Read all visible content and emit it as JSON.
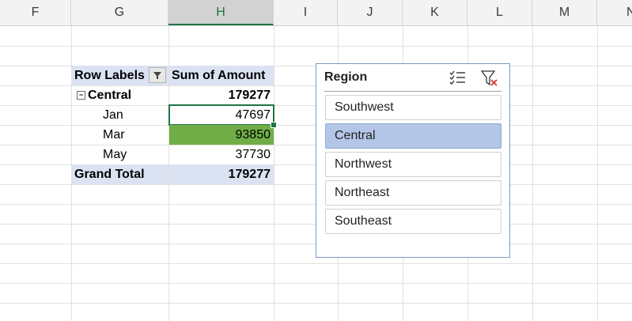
{
  "columns": [
    "F",
    "G",
    "H",
    "I",
    "J",
    "K",
    "L",
    "M",
    "N"
  ],
  "active_column": "H",
  "pivot": {
    "header_row_labels": "Row Labels",
    "header_sum": "Sum of Amount",
    "group_label": "Central",
    "group_total": "179277",
    "rows": [
      {
        "label": "Jan",
        "value": "47697"
      },
      {
        "label": "Mar",
        "value": "93850"
      },
      {
        "label": "May",
        "value": "37730"
      }
    ],
    "grand_total_label": "Grand Total",
    "grand_total_value": "179277",
    "selected_cell": "H6",
    "highlight_color": "#70ad47"
  },
  "slicer": {
    "title": "Region",
    "icons": [
      "multi-select-icon",
      "clear-filter-icon"
    ],
    "items": [
      {
        "label": "Southwest",
        "selected": false
      },
      {
        "label": "Central",
        "selected": true
      },
      {
        "label": "Northwest",
        "selected": false
      },
      {
        "label": "Northeast",
        "selected": false
      },
      {
        "label": "Southeast",
        "selected": false
      }
    ]
  },
  "colors": {
    "accent": "#217346",
    "pivot_header": "#dbe3f3",
    "slicer_selected": "#b4c6e7"
  }
}
